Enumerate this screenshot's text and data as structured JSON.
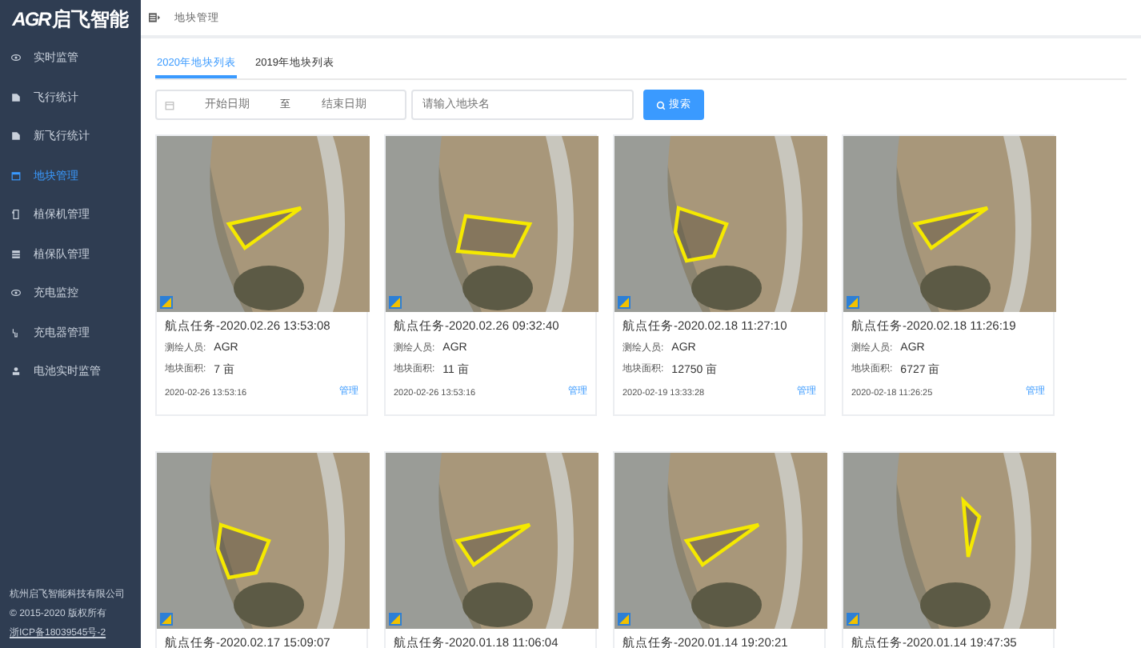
{
  "sidebar": {
    "logo": {
      "mark": "AGR",
      "text": "启飞智能"
    },
    "items": [
      {
        "label": "实时监管",
        "selected": false
      },
      {
        "label": "飞行统计",
        "selected": false
      },
      {
        "label": "新飞行统计",
        "selected": false
      },
      {
        "label": "地块管理",
        "selected": true
      },
      {
        "label": "植保机管理",
        "selected": false
      },
      {
        "label": "植保队管理",
        "selected": false
      },
      {
        "label": "充电监控",
        "selected": false
      },
      {
        "label": "充电器管理",
        "selected": false
      },
      {
        "label": "电池实时监管",
        "selected": false
      }
    ],
    "footer": {
      "company": "杭州启飞智能科技有限公司",
      "copyright": "© 2015-2020 版权所有",
      "icp": "浙ICP备18039545号-2"
    }
  },
  "header": {
    "breadcrumb": "地块管理"
  },
  "tabs": [
    {
      "label": "2020年地块列表",
      "selected": true
    },
    {
      "label": "2019年地块列表",
      "selected": false
    }
  ],
  "filters": {
    "start_placeholder": "开始日期",
    "separator": "至",
    "end_placeholder": "结束日期",
    "name_placeholder": "请输入地块名",
    "search_button": "搜索"
  },
  "cards": [
    {
      "title": "航点任务-2020.02.26 13:53:08",
      "surveyor_label": "测绘人员:",
      "surveyor": "AGR",
      "area_label": "地块面积:",
      "area": "7 亩",
      "timestamp": "2020-02-26 13:53:16",
      "action": "管理"
    },
    {
      "title": "航点任务-2020.02.26 09:32:40",
      "surveyor_label": "测绘人员:",
      "surveyor": "AGR",
      "area_label": "地块面积:",
      "area": "11 亩",
      "timestamp": "2020-02-26 13:53:16",
      "action": "管理"
    },
    {
      "title": "航点任务-2020.02.18 11:27:10",
      "surveyor_label": "测绘人员:",
      "surveyor": "AGR",
      "area_label": "地块面积:",
      "area": "12750 亩",
      "timestamp": "2020-02-19 13:33:28",
      "action": "管理"
    },
    {
      "title": "航点任务-2020.02.18 11:26:19",
      "surveyor_label": "测绘人员:",
      "surveyor": "AGR",
      "area_label": "地块面积:",
      "area": "6727 亩",
      "timestamp": "2020-02-18 11:26:25",
      "action": "管理"
    },
    {
      "title": "航点任务-2020.02.17 15:09:07"
    },
    {
      "title": "航点任务-2020.01.18 11:06:04"
    },
    {
      "title": "航点任务-2020.01.14 19:20:21"
    },
    {
      "title": "航点任务-2020.01.14 19:47:35"
    }
  ]
}
